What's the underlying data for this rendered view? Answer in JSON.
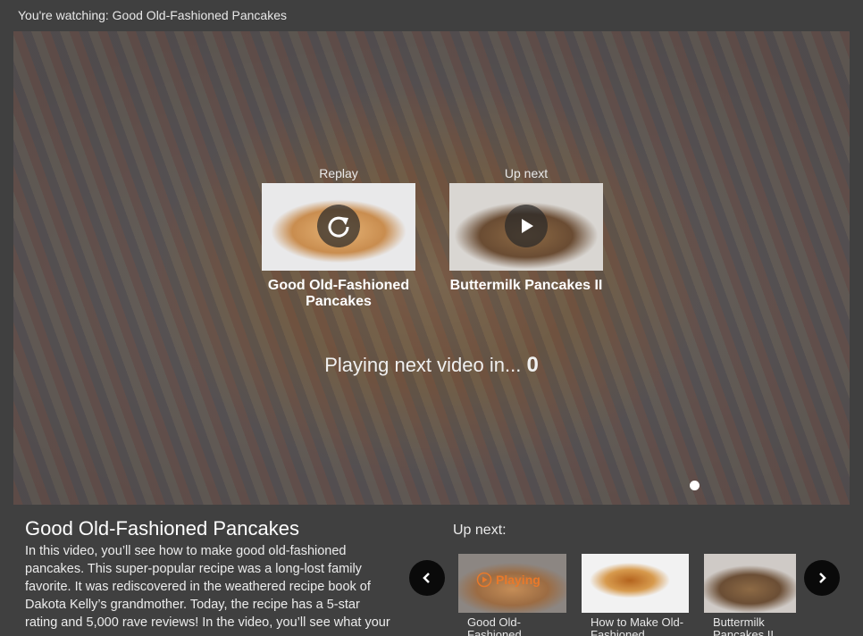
{
  "header": {
    "watching": "You're watching: Good Old-Fashioned Pancakes"
  },
  "player": {
    "replay": {
      "caption": "Replay",
      "title": "Good Old-Fashioned Pancakes",
      "icon": "replay-icon"
    },
    "up_next": {
      "caption": "Up next",
      "title": "Buttermilk Pancakes II",
      "icon": "play-icon"
    },
    "countdown_text": "Playing next video in...",
    "countdown_value": "0"
  },
  "info": {
    "title": "Good Old-Fashioned Pancakes",
    "description": "In this video, you’ll see how to make good old-fashioned pancakes. This super-popular recipe was a long-lost family favorite. It was rediscovered in the weathered recipe book of Dakota Kelly’s grandmother. Today, the recipe has a 5-star rating and 5,000 rave reviews! In the video, you’ll see what your"
  },
  "up_next_strip": {
    "label": "Up next:",
    "items": [
      {
        "label": "Good Old-Fashioned",
        "badge": "Playing"
      },
      {
        "label": "How to Make Old-Fashioned"
      },
      {
        "label": "Buttermilk Pancakes II"
      }
    ]
  },
  "colors": {
    "background": "#404040",
    "accent": "#e8792b",
    "nav_button": "#0a0a0a"
  }
}
